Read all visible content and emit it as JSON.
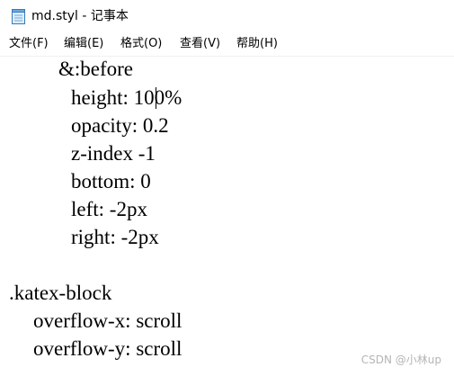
{
  "window": {
    "title": "md.styl - 记事本",
    "app_icon": "notepad-icon"
  },
  "menu": {
    "items": [
      {
        "label": "文件(F)"
      },
      {
        "label": "编辑(E)"
      },
      {
        "label": "格式(O)"
      },
      {
        "label": "查看(V)"
      },
      {
        "label": "帮助(H)"
      }
    ]
  },
  "editor": {
    "lines": [
      "&:before",
      "height: 100%",
      "opacity: 0.2",
      "z-index -1",
      "bottom: 0",
      "left: -2px",
      "right: -2px",
      "",
      ".katex-block",
      "overflow-x: scroll",
      "overflow-y: scroll"
    ]
  },
  "watermark": {
    "text": "CSDN @小林up"
  },
  "colors": {
    "background": "#ffffff",
    "text": "#000000",
    "watermark": "#b5b5b5"
  }
}
